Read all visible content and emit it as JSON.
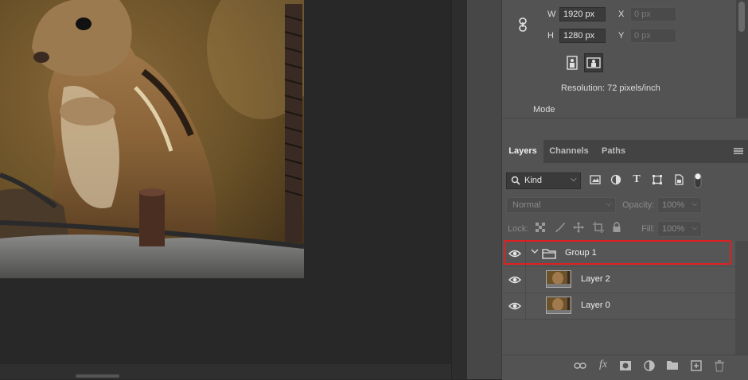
{
  "properties": {
    "w_label": "W",
    "w_value": "1920 px",
    "h_label": "H",
    "h_value": "1280 px",
    "x_label": "X",
    "x_placeholder": "0 px",
    "y_label": "Y",
    "y_placeholder": "0 px",
    "resolution": "Resolution: 72 pixels/inch",
    "mode_label": "Mode"
  },
  "layers_panel": {
    "tabs": [
      {
        "label": "Layers",
        "active": true
      },
      {
        "label": "Channels",
        "active": false
      },
      {
        "label": "Paths",
        "active": false
      }
    ],
    "filter_kind": "Kind",
    "blend_mode": "Normal",
    "opacity_label": "Opacity:",
    "opacity_value": "100%",
    "lock_label": "Lock:",
    "fill_label": "Fill:",
    "fill_value": "100%",
    "layers": [
      {
        "name": "Group 1",
        "type": "group",
        "visible": true,
        "highlighted": true
      },
      {
        "name": "Layer 2",
        "type": "pixel",
        "visible": true
      },
      {
        "name": "Layer 0",
        "type": "pixel",
        "visible": true
      }
    ]
  },
  "colors": {
    "highlight_border": "#e02020",
    "panel_bg": "#535353",
    "canvas_bg": "#282828"
  }
}
